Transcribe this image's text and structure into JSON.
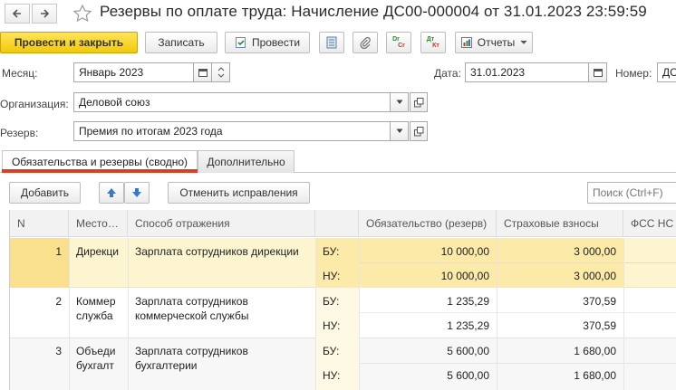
{
  "window": {
    "title": "Резервы по оплате труда: Начисление ДС00-000004 от 31.01.2023 23:59:59"
  },
  "toolbar": {
    "post_and_close": "Провести и закрыть",
    "save": "Записать",
    "post": "Провести",
    "dt_label": "Dr",
    "kt_label": "Cr",
    "dtkt_top": "Дт",
    "dtkt_bottom": "Кт",
    "reports": "Отчеты"
  },
  "form": {
    "month_label": "Месяц:",
    "month_value": "Январь 2023",
    "date_label": "Дата:",
    "date_value": "31.01.2023",
    "number_label": "Номер:",
    "number_value": "ДС",
    "org_label": "Организация:",
    "org_value": "Деловой союз",
    "reserve_label": "Резерв:",
    "reserve_value": "Премия по итогам 2023 года"
  },
  "tabs": [
    {
      "label": "Обязательства и резервы (сводно)",
      "active": true
    },
    {
      "label": "Дополнительно",
      "active": false
    }
  ],
  "table_toolbar": {
    "add": "Добавить",
    "cancel_fixes": "Отменить исправления",
    "search_placeholder": "Поиск (Ctrl+F)"
  },
  "table": {
    "columns": [
      "N",
      "Место…",
      "Способ отражения",
      "",
      "Обязательство (резерв)",
      "Страховые взносы",
      "ФСС НС"
    ],
    "rows": [
      {
        "n": "1",
        "place": "Дирекци",
        "place2": "",
        "method": "Зарплата сотрудников дирекции",
        "method2": "",
        "bu_label": "БУ:",
        "nu_label": "НУ:",
        "bu_obligation": "10 000,00",
        "bu_insurance": "3 000,00",
        "nu_obligation": "10 000,00",
        "nu_insurance": "3 000,00",
        "selected": true
      },
      {
        "n": "2",
        "place": "Коммер",
        "place2": "служба",
        "method": "Зарплата сотрудников",
        "method2": "коммерческой службы",
        "bu_label": "БУ:",
        "nu_label": "НУ:",
        "bu_obligation": "1 235,29",
        "bu_insurance": "370,59",
        "nu_obligation": "1 235,29",
        "nu_insurance": "370,59",
        "selected": false
      },
      {
        "n": "3",
        "place": "Объеди",
        "place2": "бухгалт",
        "method": "Зарплата сотрудников",
        "method2": "бухгалтерии",
        "bu_label": "БУ:",
        "nu_label": "НУ:",
        "bu_obligation": "5 600,00",
        "bu_insurance": "1 680,00",
        "nu_obligation": "5 600,00",
        "nu_insurance": "1 680,00",
        "selected": false
      }
    ]
  },
  "colors": {
    "primary_button": "#f2c90b",
    "selected_row": "#fbeaa8",
    "selected_row_light": "#fdf5cf",
    "bu_nu_column": "#fdf9e4",
    "tab_underline": "#d9411e"
  }
}
